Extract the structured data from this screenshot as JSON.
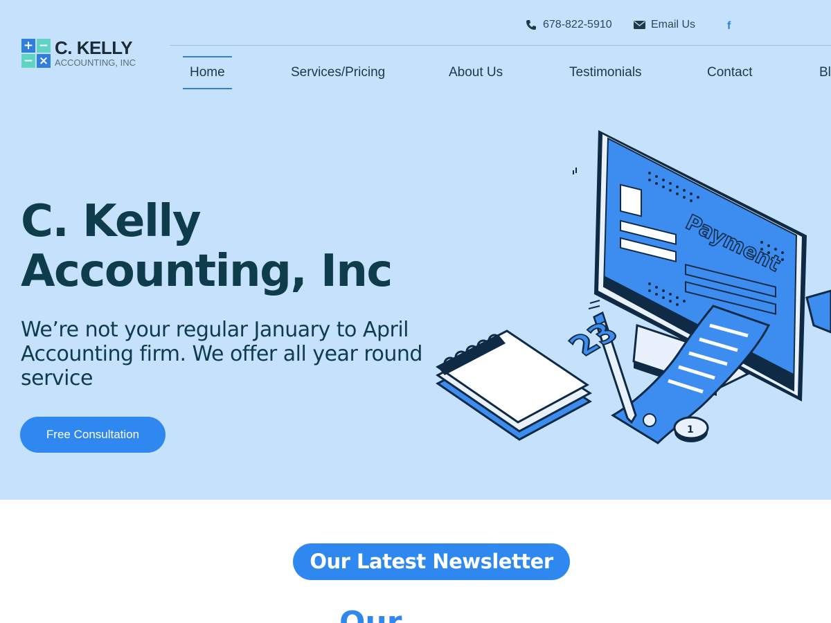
{
  "brand": {
    "logo_line1": "C. KELLY",
    "logo_line2": "ACCOUNTING, INC",
    "logo_symbols": [
      "+",
      "−",
      "−",
      "×"
    ]
  },
  "contact": {
    "phone": "678-822-5910",
    "email_label": "Email Us",
    "facebook_glyph": "f",
    "phone_icon": "phone-icon",
    "email_icon": "envelope-icon"
  },
  "nav": {
    "items": [
      {
        "label": "Home",
        "active": true
      },
      {
        "label": "Services/Pricing"
      },
      {
        "label": "About Us"
      },
      {
        "label": "Testimonials"
      },
      {
        "label": "Contact"
      },
      {
        "label": "Bl"
      }
    ]
  },
  "hero": {
    "title_line1": "C. Kelly",
    "title_line2": "Accounting, Inc",
    "subtitle": "We’re not your regular January to April Accounting firm. We offer all year round service",
    "cta_label": "Free Consultation",
    "illustration": {
      "screen_text": "Payment",
      "calendar_day": "23",
      "coin_text": "1"
    }
  },
  "newsletter": {
    "heading": "Our Latest Newsletter"
  },
  "next_section": {
    "heading_partial": "Our Servi"
  },
  "colors": {
    "hero_bg": "#c5e1fb",
    "accent": "#2f87f0",
    "heading": "#0e3c4a",
    "logo_teal": "#5fd3c4"
  }
}
